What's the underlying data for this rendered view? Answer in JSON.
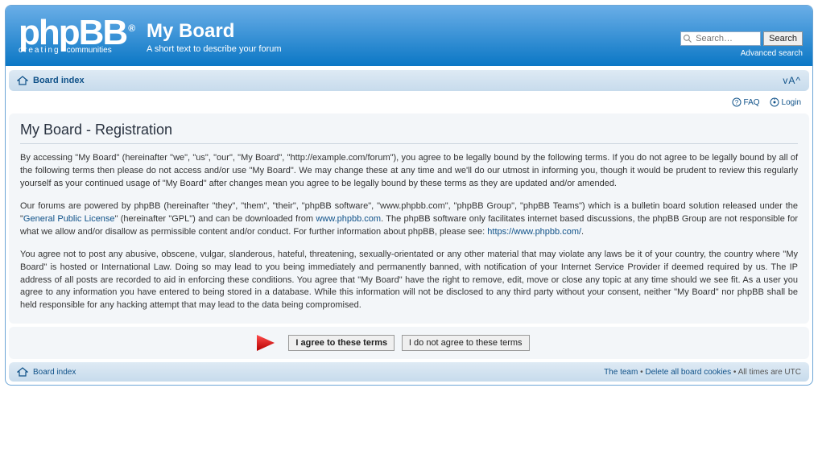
{
  "header": {
    "logo_word": "phpBB",
    "logo_reg": "®",
    "logo_sub_left": "creating",
    "logo_sub_right": "communities",
    "site_title": "My Board",
    "site_desc": "A short text to describe your forum"
  },
  "search": {
    "placeholder": "Search…",
    "button": "Search",
    "advanced": "Advanced search"
  },
  "nav": {
    "board_index": "Board index",
    "font_resize": "ᴠA^"
  },
  "topright": {
    "faq": "FAQ",
    "login": "Login"
  },
  "registration": {
    "heading": "My Board - Registration",
    "p1a": "By accessing \"My Board\" (hereinafter \"we\", \"us\", \"our\", \"My Board\", \"http://example.com/forum\"), you agree to be legally bound by the following terms. If you do not agree to be legally bound by all of the following terms then please do not access and/or use \"My Board\". We may change these at any time and we'll do our utmost in informing you, though it would be prudent to review this regularly yourself as your continued usage of \"My Board\" after changes mean you agree to be legally bound by these terms as they are updated and/or amended.",
    "p2a": "Our forums are powered by phpBB (hereinafter \"they\", \"them\", \"their\", \"phpBB software\", \"www.phpbb.com\", \"phpBB Group\", \"phpBB Teams\") which is a bulletin board solution released under the \"",
    "p2_gpl": "General Public License",
    "p2b": "\" (hereinafter \"GPL\") and can be downloaded from ",
    "p2_phpbb": "www.phpbb.com",
    "p2c": ". The phpBB software only facilitates internet based discussions, the phpBB Group are not responsible for what we allow and/or disallow as permissible content and/or conduct. For further information about phpBB, please see: ",
    "p2_url": "https://www.phpbb.com/",
    "p2d": ".",
    "p3": "You agree not to post any abusive, obscene, vulgar, slanderous, hateful, threatening, sexually-orientated or any other material that may violate any laws be it of your country, the country where \"My Board\" is hosted or International Law. Doing so may lead to you being immediately and permanently banned, with notification of your Internet Service Provider if deemed required by us. The IP address of all posts are recorded to aid in enforcing these conditions. You agree that \"My Board\" have the right to remove, edit, move or close any topic at any time should we see fit. As a user you agree to any information you have entered to being stored in a database. While this information will not be disclosed to any third party without your consent, neither \"My Board\" nor phpBB shall be held responsible for any hacking attempt that may lead to the data being compromised."
  },
  "buttons": {
    "agree": "I agree to these terms",
    "disagree": "I do not agree to these terms"
  },
  "footer": {
    "board_index": "Board index",
    "team": "The team",
    "sep": " • ",
    "cookies": "Delete all board cookies",
    "tz": "All times are UTC"
  }
}
